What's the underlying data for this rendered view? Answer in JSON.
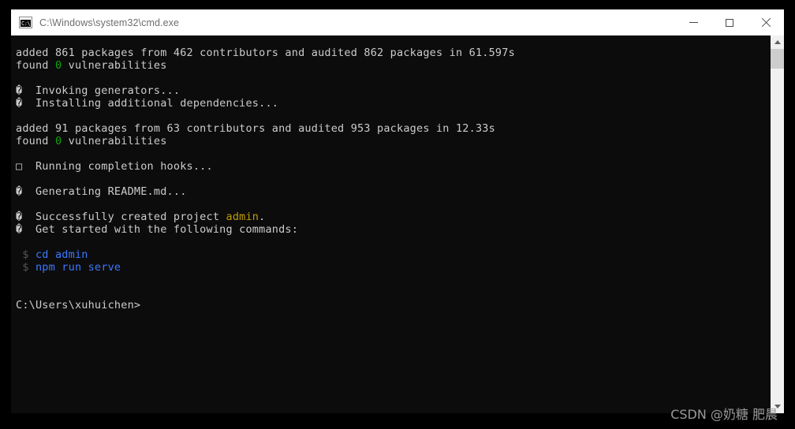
{
  "window": {
    "title": "C:\\Windows\\system32\\cmd.exe",
    "icon_name": "cmd-console-icon",
    "icon_text": "C:\\",
    "controls": {
      "minimize_label": "Minimize",
      "maximize_label": "Maximize",
      "close_label": "Close"
    }
  },
  "colors": {
    "console_background": "#0c0c0c",
    "titlebar_background": "#ffffff",
    "default_text": "#cccccc",
    "green": "#13a10e",
    "yellow": "#c19c00",
    "blue": "#3b78ff",
    "prompt_gray": "#555555",
    "scrollbar_track": "#f0f0f0",
    "scrollbar_thumb": "#cdcdcd",
    "watermark_text": "#9a9a9a"
  },
  "terminal": {
    "lines": [
      {
        "id": "line-npm-added-1",
        "segments": [
          {
            "text": "added 861 packages from 462 contributors and audited 862 packages in 61.597s",
            "color": "white"
          }
        ]
      },
      {
        "id": "line-npm-found-1",
        "segments": [
          {
            "text": "found ",
            "color": "white"
          },
          {
            "text": "0",
            "color": "green"
          },
          {
            "text": " vulnerabilities",
            "color": "white"
          }
        ]
      },
      {
        "id": "line-blank-1",
        "segments": [
          {
            "text": "",
            "color": "white"
          }
        ]
      },
      {
        "id": "line-invoking-generators",
        "segments": [
          {
            "text": "�  Invoking generators...",
            "color": "white"
          }
        ]
      },
      {
        "id": "line-installing-deps",
        "segments": [
          {
            "text": "�  Installing additional dependencies...",
            "color": "white"
          }
        ]
      },
      {
        "id": "line-blank-2",
        "segments": [
          {
            "text": "",
            "color": "white"
          }
        ]
      },
      {
        "id": "line-npm-added-2",
        "segments": [
          {
            "text": "added 91 packages from 63 contributors and audited 953 packages in 12.33s",
            "color": "white"
          }
        ]
      },
      {
        "id": "line-npm-found-2",
        "segments": [
          {
            "text": "found ",
            "color": "white"
          },
          {
            "text": "0",
            "color": "green"
          },
          {
            "text": " vulnerabilities",
            "color": "white"
          }
        ]
      },
      {
        "id": "line-blank-3",
        "segments": [
          {
            "text": "",
            "color": "white"
          }
        ]
      },
      {
        "id": "line-completion-hooks",
        "segments": [
          {
            "text": "□  Running completion hooks...",
            "color": "white"
          }
        ]
      },
      {
        "id": "line-blank-4",
        "segments": [
          {
            "text": "",
            "color": "white"
          }
        ]
      },
      {
        "id": "line-generating-readme",
        "segments": [
          {
            "text": "�  Generating README.md...",
            "color": "white"
          }
        ]
      },
      {
        "id": "line-blank-5",
        "segments": [
          {
            "text": "",
            "color": "white"
          }
        ]
      },
      {
        "id": "line-created-project",
        "segments": [
          {
            "text": "�  Successfully created project ",
            "color": "white"
          },
          {
            "text": "admin",
            "color": "yellow"
          },
          {
            "text": ".",
            "color": "white"
          }
        ]
      },
      {
        "id": "line-get-started",
        "segments": [
          {
            "text": "�  Get started with the following commands:",
            "color": "white"
          }
        ]
      },
      {
        "id": "line-blank-6",
        "segments": [
          {
            "text": "",
            "color": "white"
          }
        ]
      },
      {
        "id": "line-cmd-cd",
        "segments": [
          {
            "text": " $ ",
            "color": "gray"
          },
          {
            "text": "cd admin",
            "color": "blue"
          }
        ]
      },
      {
        "id": "line-cmd-serve",
        "segments": [
          {
            "text": " $ ",
            "color": "gray"
          },
          {
            "text": "npm run serve",
            "color": "blue"
          }
        ]
      },
      {
        "id": "line-blank-7",
        "segments": [
          {
            "text": "",
            "color": "white"
          }
        ]
      },
      {
        "id": "line-blank-8",
        "segments": [
          {
            "text": "",
            "color": "white"
          }
        ]
      },
      {
        "id": "line-prompt",
        "segments": [
          {
            "text": "C:\\Users\\xuhuichen>",
            "color": "white"
          }
        ]
      }
    ]
  },
  "scrollbar": {
    "up_arrow_label": "Scroll up",
    "down_arrow_label": "Scroll down",
    "thumb_label": "Scroll thumb"
  },
  "watermark": {
    "text": "CSDN @奶糖 肥晨"
  }
}
